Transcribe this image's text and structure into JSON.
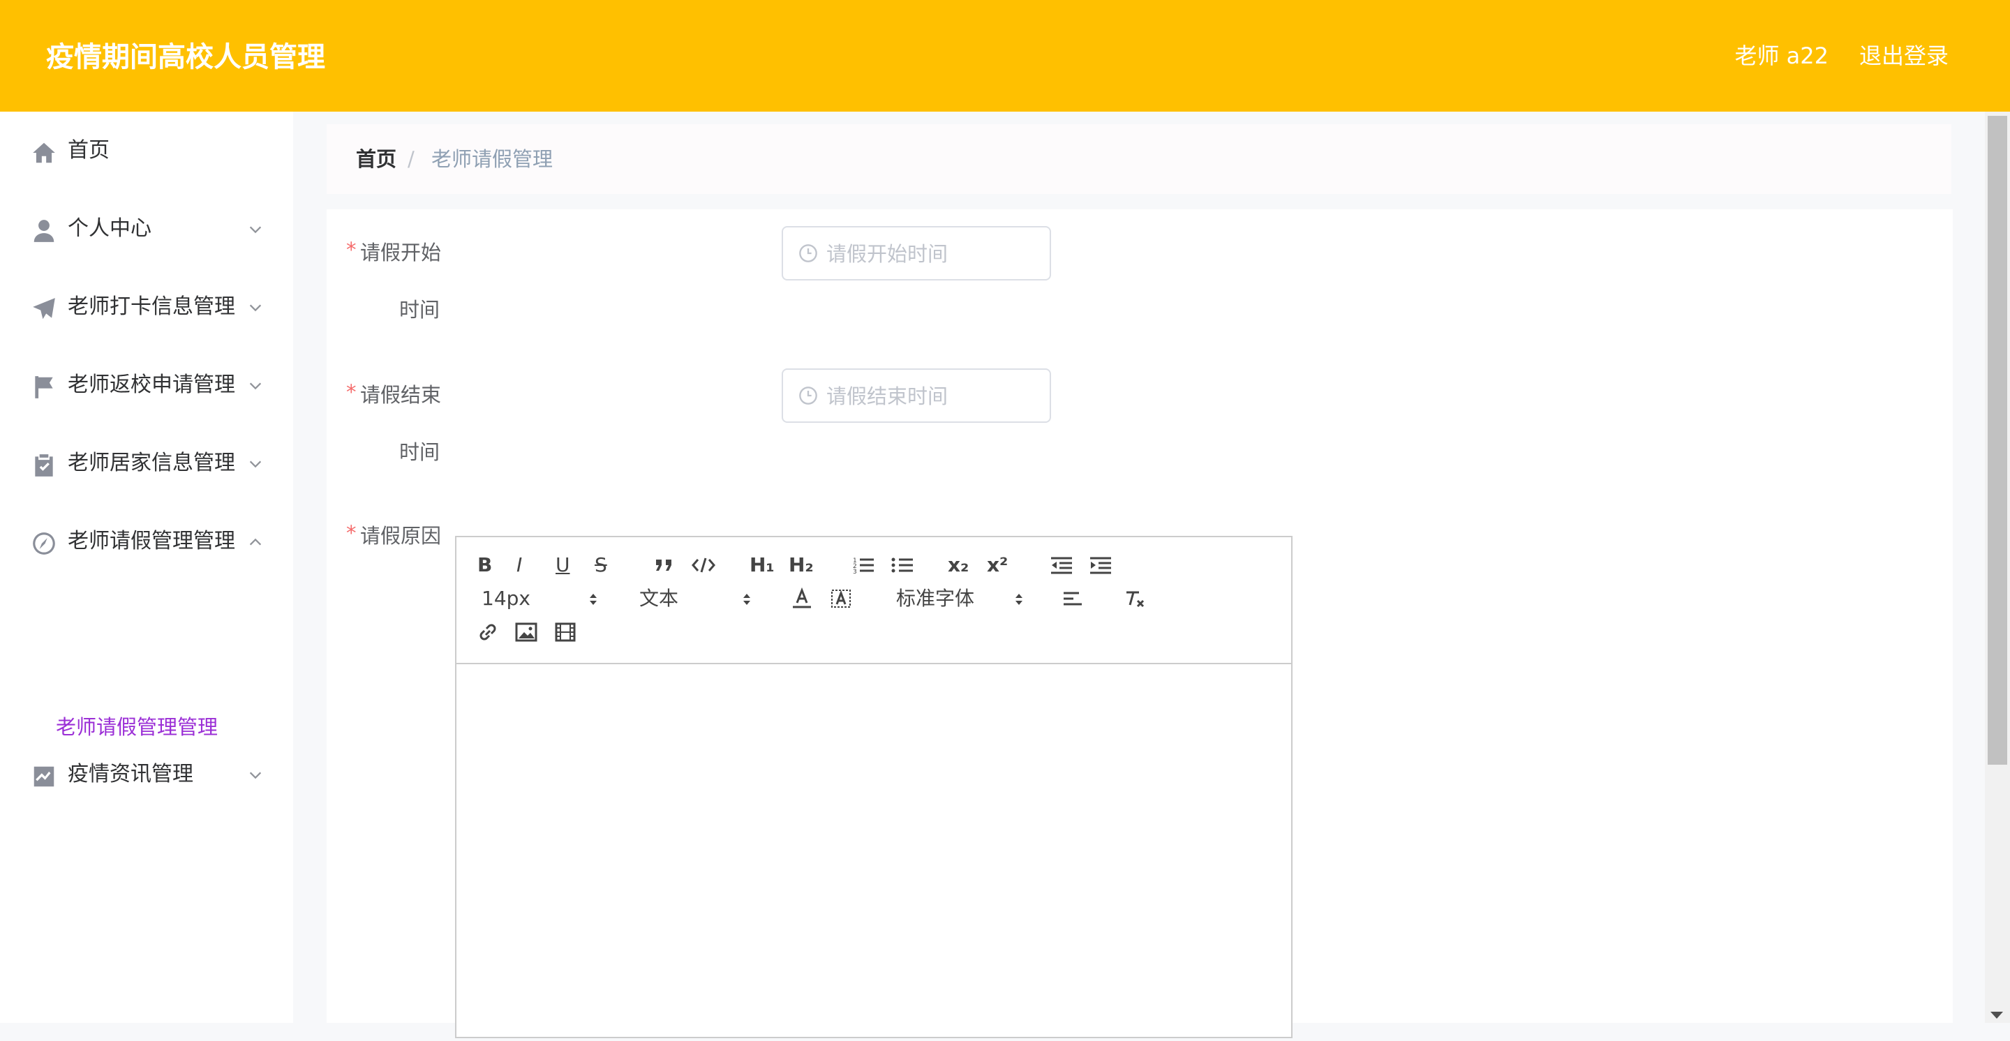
{
  "header": {
    "title": "疫情期间高校人员管理",
    "user": "老师 a22",
    "logout": "退出登录"
  },
  "sidebar": {
    "items": [
      {
        "label": "首页"
      },
      {
        "label": "个人中心"
      },
      {
        "label": "老师打卡信息管理"
      },
      {
        "label": "老师返校申请管理"
      },
      {
        "label": "老师居家信息管理"
      },
      {
        "label": "老师请假管理管理"
      },
      {
        "label": "疫情资讯管理"
      }
    ],
    "active_sub": "老师请假管理管理"
  },
  "breadcrumb": {
    "home": "首页",
    "sep": "/",
    "current": "老师请假管理"
  },
  "form": {
    "start_label_1": "请假开始",
    "start_label_2": "时间",
    "start_placeholder": "请假开始时间",
    "end_label_1": "请假结束",
    "end_label_2": "时间",
    "end_placeholder": "请假结束时间",
    "reason_label": "请假原因",
    "required_mark": "*"
  },
  "editor": {
    "font_size": "14px",
    "header_select": "文本",
    "font_family": "标准字体",
    "bold": "B",
    "italic": "I",
    "underline": "U",
    "strike": "S",
    "h1": "H₁",
    "h2": "H₂",
    "sub": "x₂",
    "sup": "x²"
  },
  "colors": {
    "header": "#ffc000",
    "active_sub": "#9b2fd6",
    "required": "#f56c6c"
  }
}
